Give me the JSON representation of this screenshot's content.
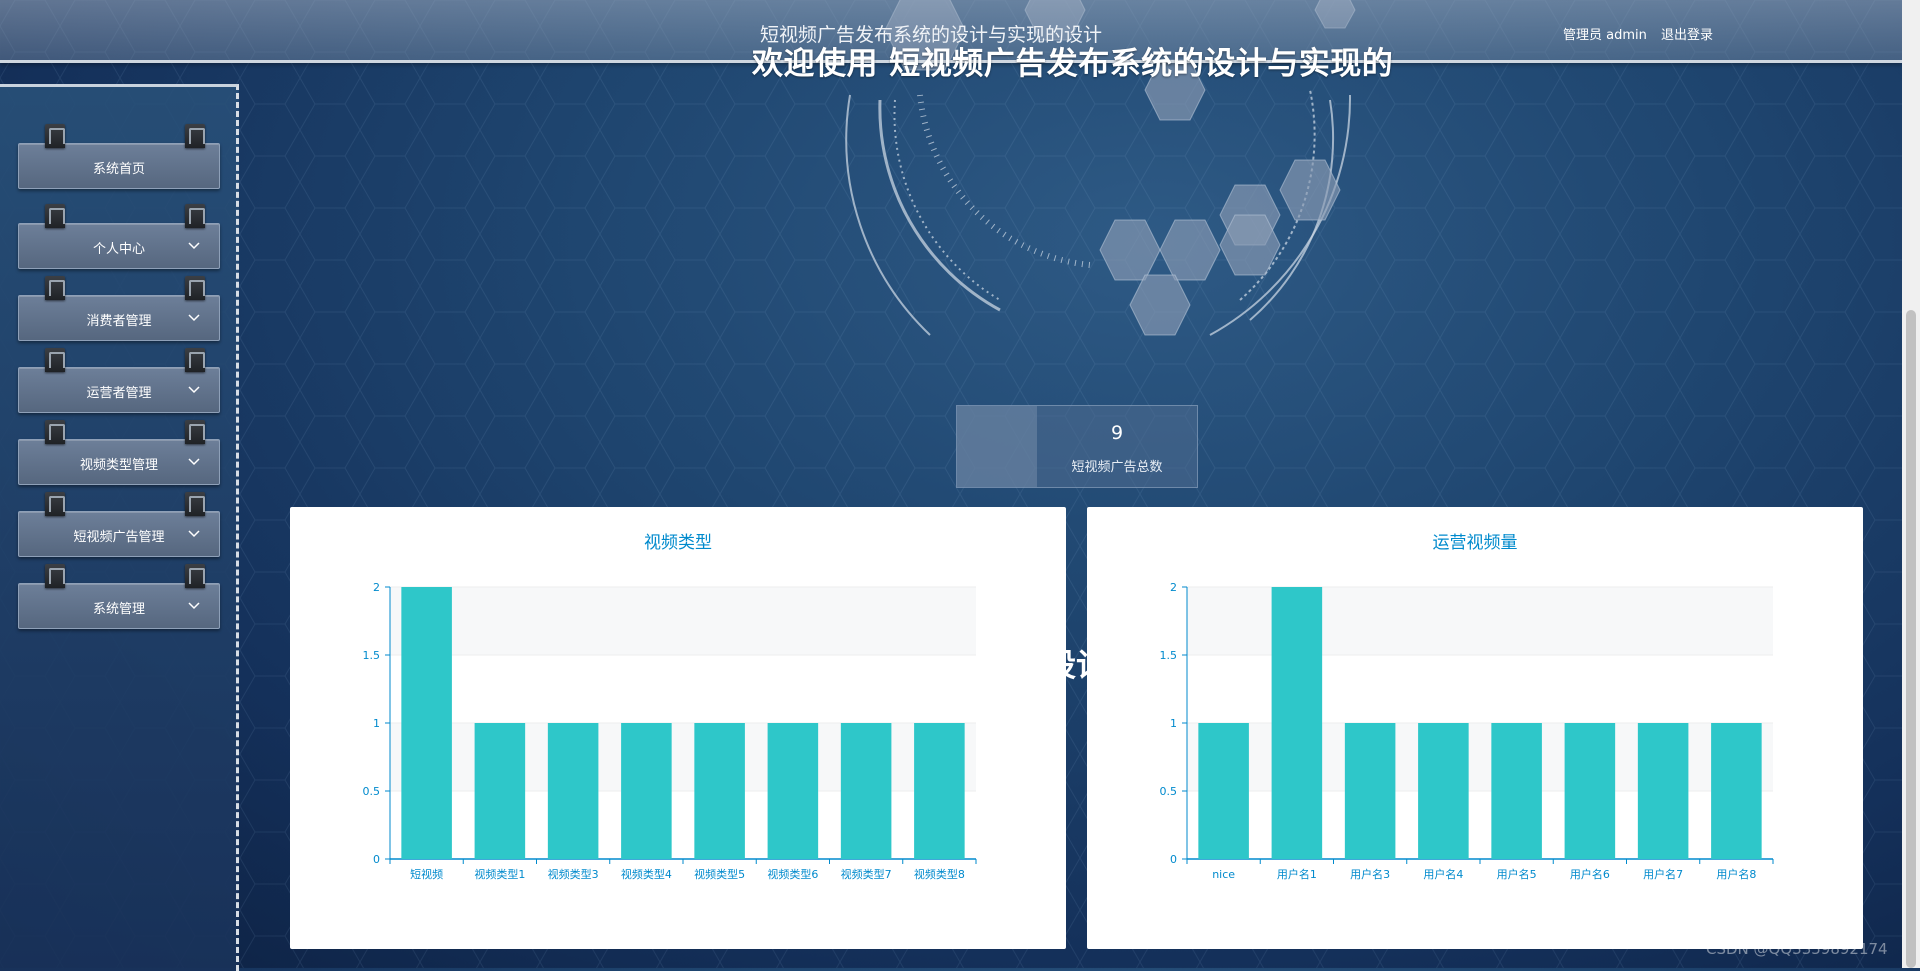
{
  "header": {
    "system_title": "短视频广告发布系统的设计与实现的设计",
    "welcome": "欢迎使用 短视频广告发布系统的设计与实现的",
    "user_label": "管理员 admin",
    "logout": "退出登录"
  },
  "sidebar": {
    "items": [
      {
        "label": "系统首页",
        "has_chevron": false
      },
      {
        "label": "个人中心",
        "has_chevron": true
      },
      {
        "label": "消费者管理",
        "has_chevron": true
      },
      {
        "label": "运营者管理",
        "has_chevron": true
      },
      {
        "label": "视频类型管理",
        "has_chevron": true
      },
      {
        "label": "短视频广告管理",
        "has_chevron": true
      },
      {
        "label": "系统管理",
        "has_chevron": true
      }
    ]
  },
  "stat": {
    "value": "9",
    "label": "短视频广告总数"
  },
  "overlap_text": "设计",
  "watermark": "CSDN @QQ3359892174",
  "colors": {
    "bar": "#2ec7c9",
    "axis": "#008acd",
    "title": "#008acd"
  },
  "chart_data": [
    {
      "type": "bar",
      "title": "视频类型",
      "categories": [
        "短视频",
        "视频类型1",
        "视频类型3",
        "视频类型4",
        "视频类型5",
        "视频类型6",
        "视频类型7",
        "视频类型8"
      ],
      "values": [
        2,
        1,
        1,
        1,
        1,
        1,
        1,
        1
      ],
      "yticks": [
        "0",
        "0.5",
        "1",
        "1.5",
        "2"
      ],
      "ylim": [
        0,
        2
      ]
    },
    {
      "type": "bar",
      "title": "运营视频量",
      "categories": [
        "nice",
        "用户名1",
        "用户名3",
        "用户名4",
        "用户名5",
        "用户名6",
        "用户名7",
        "用户名8"
      ],
      "values": [
        1,
        2,
        1,
        1,
        1,
        1,
        1,
        1
      ],
      "yticks": [
        "0",
        "0.5",
        "1",
        "1.5",
        "2"
      ],
      "ylim": [
        0,
        2
      ]
    }
  ]
}
